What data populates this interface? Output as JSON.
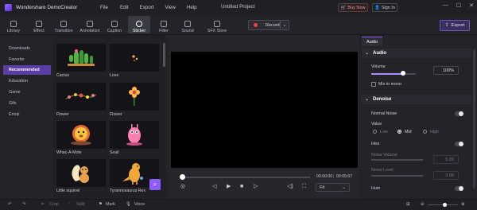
{
  "window": {
    "app_name": "Wondershare DemoCreator",
    "menu": [
      "File",
      "Edit",
      "Export",
      "View",
      "Help"
    ],
    "project_title": "Untitled Project",
    "buy_now": "Buy Now",
    "sign_in": "Sign In"
  },
  "toolbar": {
    "tools": [
      "Library",
      "Effect",
      "Transition",
      "Annotation",
      "Caption",
      "Sticker",
      "Filter",
      "Sound",
      "SFX Store"
    ],
    "active_tool": "Sticker",
    "record_label": "Record",
    "export_label": "Export"
  },
  "sidebar": {
    "items": [
      "Downloads",
      "Favorite",
      "Recommended",
      "Education",
      "Game",
      "Gifs",
      "Emoji"
    ],
    "active": "Recommended"
  },
  "stickers": [
    "Cactus",
    "Love",
    "Flower",
    "Flower",
    "Whac-A-Mole",
    "Snail",
    "Little squirrel",
    "Tyrannosaurus Rex"
  ],
  "preview": {
    "current_time": "00:00:00",
    "total_time": "00:05:07",
    "zoom": "Fit",
    "progress_fraction": 0.0
  },
  "right_panel": {
    "tab": "Audio",
    "audio_section": "Audio",
    "volume_label": "Volume",
    "volume_value": "100%",
    "volume_fraction": 0.72,
    "mix_to_mono": "Mix to mono",
    "denoise_section": "Denoise",
    "normal_noise": "Normal Noise",
    "value_label": "Value",
    "options": [
      "Low",
      "Mid",
      "High"
    ],
    "selected_option": "Mid",
    "hiss": "Hiss",
    "noise_volume": "Noise Volume",
    "noise_volume_value": "5.00",
    "noise_level": "Noise Level",
    "noise_level_value": "3.00",
    "hum": "Hum"
  },
  "bottombar": {
    "items": [
      "Crop",
      "Split",
      "Mark",
      "Voice"
    ]
  },
  "colors": {
    "accent": "#8c5cff",
    "active_sidebar": "#5a3ea6",
    "record": "#ff3b3b"
  }
}
